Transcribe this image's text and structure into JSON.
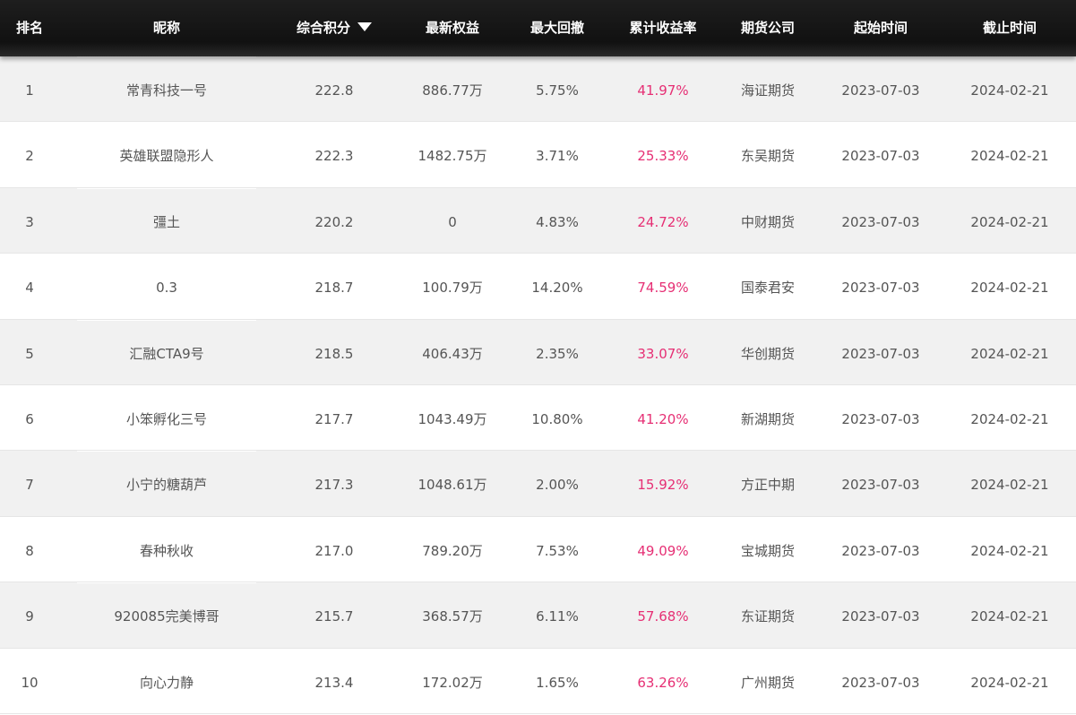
{
  "header": {
    "rank": "排名",
    "nickname": "昵称",
    "score": "综合积分",
    "equity": "最新权益",
    "drawdown": "最大回撤",
    "return_rate": "累计收益率",
    "company": "期货公司",
    "start_time": "起始时间",
    "end_time": "截止时间",
    "sort_icon": "caret-down-icon"
  },
  "colors": {
    "header_bg": "#151515",
    "header_text": "#ffffff",
    "row_alt_bg": "#f1f1f1",
    "row_bg": "#ffffff",
    "text": "#555555",
    "return_color": "#e62f74"
  },
  "rows": [
    {
      "rank": "1",
      "nickname": "常青科技一号",
      "score": "222.8",
      "equity": "886.77万",
      "drawdown": "5.75%",
      "return_rate": "41.97%",
      "company": "海证期货",
      "start": "2023-07-03",
      "end": "2024-02-21"
    },
    {
      "rank": "2",
      "nickname": "英雄联盟隐形人",
      "score": "222.3",
      "equity": "1482.75万",
      "drawdown": "3.71%",
      "return_rate": "25.33%",
      "company": "东吴期货",
      "start": "2023-07-03",
      "end": "2024-02-21"
    },
    {
      "rank": "3",
      "nickname": "彊土",
      "score": "220.2",
      "equity": "0",
      "drawdown": "4.83%",
      "return_rate": "24.72%",
      "company": "中财期货",
      "start": "2023-07-03",
      "end": "2024-02-21"
    },
    {
      "rank": "4",
      "nickname": "0.3",
      "score": "218.7",
      "equity": "100.79万",
      "drawdown": "14.20%",
      "return_rate": "74.59%",
      "company": "国泰君安",
      "start": "2023-07-03",
      "end": "2024-02-21"
    },
    {
      "rank": "5",
      "nickname": "汇融CTA9号",
      "score": "218.5",
      "equity": "406.43万",
      "drawdown": "2.35%",
      "return_rate": "33.07%",
      "company": "华创期货",
      "start": "2023-07-03",
      "end": "2024-02-21"
    },
    {
      "rank": "6",
      "nickname": "小笨孵化三号",
      "score": "217.7",
      "equity": "1043.49万",
      "drawdown": "10.80%",
      "return_rate": "41.20%",
      "company": "新湖期货",
      "start": "2023-07-03",
      "end": "2024-02-21"
    },
    {
      "rank": "7",
      "nickname": "小宁的糖葫芦",
      "score": "217.3",
      "equity": "1048.61万",
      "drawdown": "2.00%",
      "return_rate": "15.92%",
      "company": "方正中期",
      "start": "2023-07-03",
      "end": "2024-02-21"
    },
    {
      "rank": "8",
      "nickname": "春种秋收",
      "score": "217.0",
      "equity": "789.20万",
      "drawdown": "7.53%",
      "return_rate": "49.09%",
      "company": "宝城期货",
      "start": "2023-07-03",
      "end": "2024-02-21"
    },
    {
      "rank": "9",
      "nickname": "920085完美博哥",
      "score": "215.7",
      "equity": "368.57万",
      "drawdown": "6.11%",
      "return_rate": "57.68%",
      "company": "东证期货",
      "start": "2023-07-03",
      "end": "2024-02-21"
    },
    {
      "rank": "10",
      "nickname": "向心力静",
      "score": "213.4",
      "equity": "172.02万",
      "drawdown": "1.65%",
      "return_rate": "63.26%",
      "company": "广州期货",
      "start": "2023-07-03",
      "end": "2024-02-21"
    }
  ]
}
